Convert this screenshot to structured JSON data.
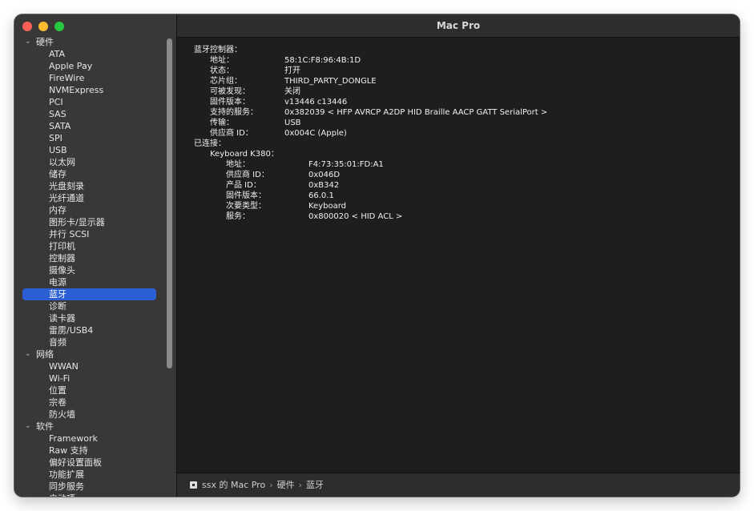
{
  "window": {
    "title": "Mac Pro"
  },
  "sidebar": {
    "groups": [
      {
        "label": "硬件",
        "items": [
          "ATA",
          "Apple Pay",
          "FireWire",
          "NVMExpress",
          "PCI",
          "SAS",
          "SATA",
          "SPI",
          "USB",
          "以太网",
          "储存",
          "光盘刻录",
          "光纤通道",
          "内存",
          "图形卡/显示器",
          "并行 SCSI",
          "打印机",
          "控制器",
          "摄像头",
          "电源",
          "蓝牙",
          "诊断",
          "读卡器",
          "雷雳/USB4",
          "音频"
        ]
      },
      {
        "label": "网络",
        "items": [
          "WWAN",
          "Wi-Fi",
          "位置",
          "宗卷",
          "防火墙"
        ]
      },
      {
        "label": "软件",
        "items": [
          "Framework",
          "Raw 支持",
          "偏好设置面板",
          "功能扩展",
          "同步服务",
          "启动项"
        ]
      }
    ],
    "selected": "蓝牙"
  },
  "detail": {
    "controller_heading": "蓝牙控制器：",
    "controller": [
      {
        "key": "地址：",
        "value": "58:1C:F8:96:4B:1D"
      },
      {
        "key": "状态：",
        "value": "打开"
      },
      {
        "key": "芯片组：",
        "value": "THIRD_PARTY_DONGLE"
      },
      {
        "key": "可被发现：",
        "value": "关闭"
      },
      {
        "key": "固件版本：",
        "value": "v13446 c13446"
      },
      {
        "key": "支持的服务：",
        "value": "0x382039 < HFP AVRCP A2DP HID Braille AACP GATT SerialPort >"
      },
      {
        "key": "传输：",
        "value": "USB"
      },
      {
        "key": "供应商 ID：",
        "value": "0x004C (Apple)"
      }
    ],
    "connected_heading": "已连接：",
    "device_name": "Keyboard K380：",
    "device": [
      {
        "key": "地址：",
        "value": "F4:73:35:01:FD:A1"
      },
      {
        "key": "供应商 ID：",
        "value": "0x046D"
      },
      {
        "key": "产品 ID：",
        "value": "0xB342"
      },
      {
        "key": "固件版本：",
        "value": "66.0.1"
      },
      {
        "key": "次要类型：",
        "value": "Keyboard"
      },
      {
        "key": "服务：",
        "value": "0x800020 < HID ACL >"
      }
    ]
  },
  "statusbar": {
    "path": [
      "ssx 的 Mac Pro",
      "硬件",
      "蓝牙"
    ],
    "separator": "›"
  }
}
